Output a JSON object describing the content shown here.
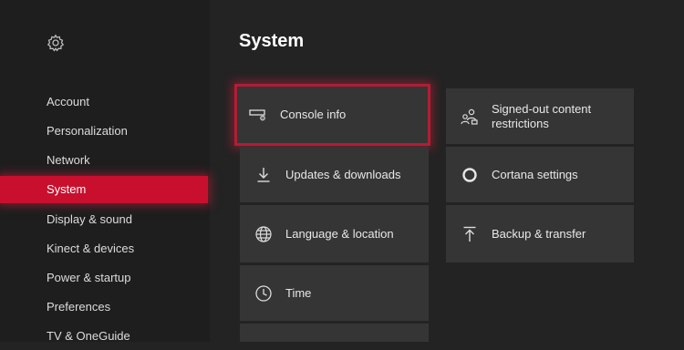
{
  "sidebar": {
    "settings_icon": "gear-icon",
    "items": [
      {
        "label": "Account"
      },
      {
        "label": "Personalization"
      },
      {
        "label": "Network"
      },
      {
        "label": "System"
      },
      {
        "label": "Display & sound"
      },
      {
        "label": "Kinect & devices"
      },
      {
        "label": "Power & startup"
      },
      {
        "label": "Preferences"
      },
      {
        "label": "TV & OneGuide"
      }
    ],
    "active_item": "System"
  },
  "main": {
    "title": "System",
    "tiles": [
      {
        "label": "Console info",
        "icon": "console-icon",
        "selected": true
      },
      {
        "label": "Updates & downloads",
        "icon": "download-icon"
      },
      {
        "label": "Language & location",
        "icon": "globe-icon"
      },
      {
        "label": "Time",
        "icon": "clock-icon"
      },
      {
        "label": "Signed-out content restrictions",
        "icon": "users-lock-icon"
      },
      {
        "label": "Cortana settings",
        "icon": "cortana-ring-icon"
      },
      {
        "label": "Backup & transfer",
        "icon": "upload-icon"
      }
    ]
  },
  "colors": {
    "accent": "#c8102e",
    "background": "#232323",
    "tile": "#353535"
  }
}
